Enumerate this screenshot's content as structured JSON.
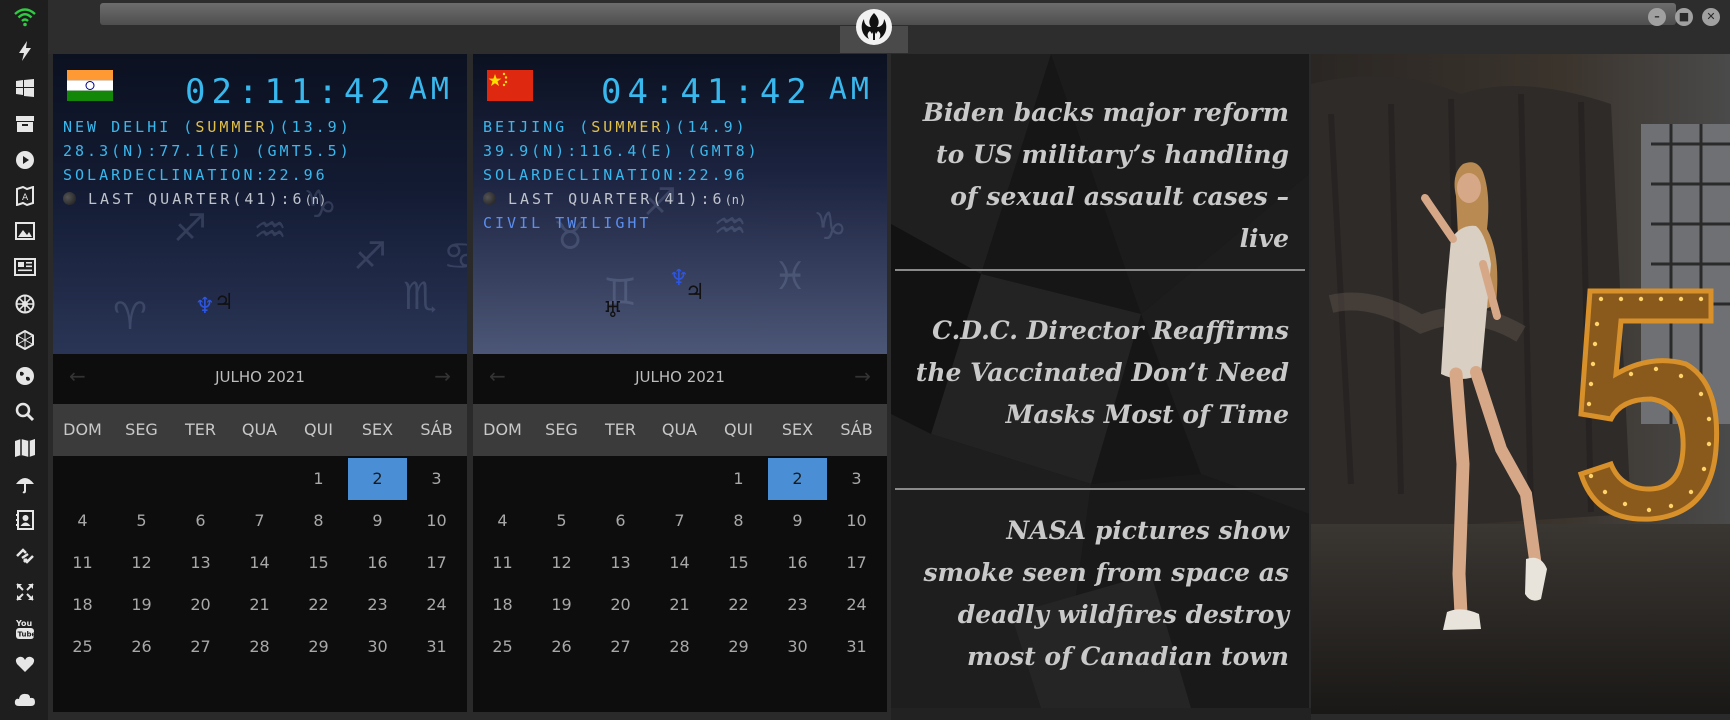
{
  "sidebar_icons": [
    "wifi-icon",
    "flash-icon",
    "windows-icon",
    "archive-icon",
    "play-icon",
    "map-book-icon",
    "image-icon",
    "news-icon",
    "settings-gear-icon",
    "hexagon-icon",
    "globe-icon",
    "search-icon",
    "map-icon",
    "umbrella-icon",
    "contact-icon",
    "link-icon",
    "fullscreen-icon",
    "youtube-icon",
    "heart-icon",
    "cloud-icon"
  ],
  "clocks": [
    {
      "time": "02:11:42",
      "ampm": "AM",
      "city_prefix": "NEW DELHI (",
      "season": "SUMMER",
      "city_suffix": ")(13.9)",
      "coords": "28.3(N):77.1(E) (GMT5.5)",
      "solar": "SOLARDECLINATION:22.96",
      "moon": "LAST QUARTER(41):6",
      "moon_sup": "(n)",
      "twilight": ""
    },
    {
      "time": "04:41:42",
      "ampm": "AM",
      "city_prefix": "BEIJING (",
      "season": "SUMMER",
      "city_suffix": ")(14.9)",
      "coords": "39.9(N):116.4(E) (GMT8)",
      "solar": "SOLARDECLINATION:22.96",
      "moon": "LAST QUARTER(41):6",
      "moon_sup": "(n)",
      "twilight": "CIVIL TWILIGHT"
    }
  ],
  "calendar": {
    "month_label": "JULHO 2021",
    "weekdays": [
      "DOM",
      "SEG",
      "TER",
      "QUA",
      "QUI",
      "SEX",
      "SÁB"
    ],
    "first_weekday_index": 4,
    "days_in_month": 31,
    "selected_day": 2,
    "prev_arrow": "←",
    "next_arrow": "→"
  },
  "news": {
    "headlines": [
      "Biden backs major reform to US military’s handling of sexual assault cases – live",
      "C.D.C. Director Reaffirms the Vaccinated Don’t Need Masks Most of Time",
      "NASA pictures show smoke seen from space as deadly wildfires destroy most of Canadian town"
    ]
  },
  "window": {
    "minimize": "–",
    "maximize": "■",
    "close": "✕"
  },
  "photo": {
    "sign_digit": "5"
  },
  "colors": {
    "accent": "#39b8ee",
    "highlight": "#e1c04a",
    "selected_day": "#4a8fd6"
  }
}
